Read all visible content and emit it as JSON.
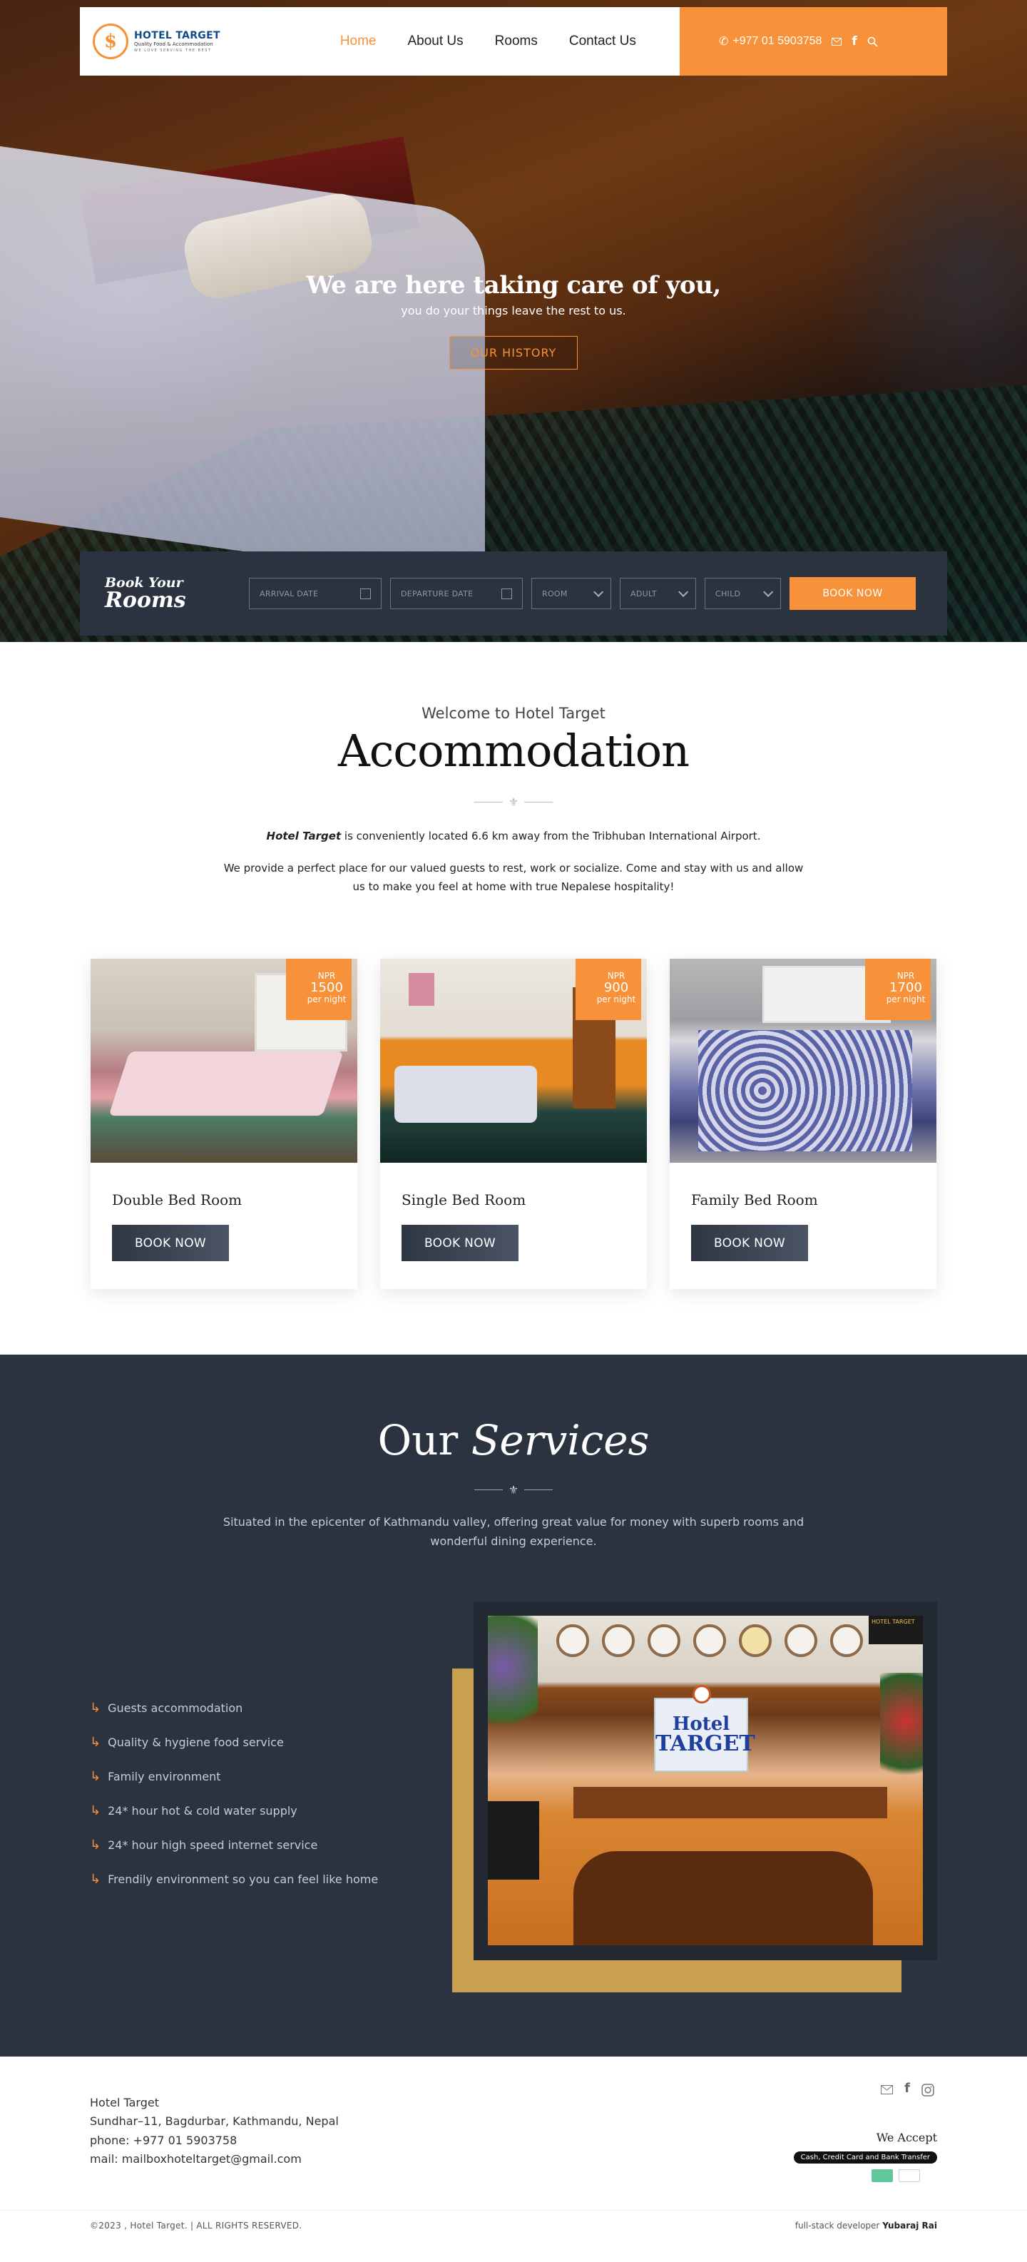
{
  "header": {
    "logo": {
      "name": "HOTEL TARGET",
      "tagline": "Quality Food & Accommodation",
      "motto": "WE LOVE SERVING THE BEST"
    },
    "nav": [
      {
        "label": "Home"
      },
      {
        "label": "About Us"
      },
      {
        "label": "Rooms"
      },
      {
        "label": "Contact Us"
      }
    ],
    "phone": "+977 01 5903758",
    "icons": [
      "mail-icon",
      "facebook-icon",
      "search-icon"
    ]
  },
  "hero": {
    "title": "We are here taking care of you,",
    "subtitle": "you do your things leave the rest to us.",
    "cta": "OUR HISTORY"
  },
  "booking": {
    "title_line1": "Book Your",
    "title_line2": "Rooms",
    "arrival_placeholder": "ARRIVAL DATE",
    "departure_placeholder": "DEPARTURE DATE",
    "room_select": "ROOM",
    "adult_select": "ADULT",
    "child_select": "CHILD",
    "submit": "BOOK NOW"
  },
  "accommodation": {
    "welcome": "Welcome to Hotel Target",
    "title": "Accommodation",
    "desc_brand": "Hotel Target",
    "desc_rest": " is conveniently located 6.6 km away from the Tribhuban International Airport.",
    "desc2": "We provide a perfect place for our valued guests to rest, work or socialize. Come and stay with us and allow us to make you feel at home with true Nepalese hospitality!",
    "rooms": [
      {
        "name": "Double Bed Room",
        "currency": "NPR",
        "price": "1500",
        "unit": "per night",
        "cta": "BOOK NOW"
      },
      {
        "name": "Single Bed Room",
        "currency": "NPR",
        "price": "900",
        "unit": "per night",
        "cta": "BOOK NOW"
      },
      {
        "name": "Family Bed Room",
        "currency": "NPR",
        "price": "1700",
        "unit": "per night",
        "cta": "BOOK NOW"
      }
    ]
  },
  "services": {
    "title_plain": "Our",
    "title_italic": "Services",
    "intro": "Situated in the epicenter of Kathmandu valley, offering great value for money with superb rooms and wonderful dining experience.",
    "items": [
      "Guests accommodation",
      "Quality & hygiene food service",
      "Family environment",
      "24* hour hot & cold water supply",
      "24* hour high speed internet service",
      "Frendily environment so you can feel like home"
    ],
    "photo_sign_line1": "Hotel",
    "photo_sign_line2": "TARGET",
    "photo_board": "HOTEL TARGET"
  },
  "footer": {
    "name": "Hotel Target",
    "address": "Sundhar–11, Bagdurbar, Kathmandu, Nepal",
    "phone": "phone: +977 01 5903758",
    "mail": "mail: mailboxhoteltarget@gmail.com",
    "we_accept": "We Accept",
    "payment": "Cash, Credit Card and Bank Transfer",
    "copyright": "©2023 , Hotel Target. | ALL RIGHTS RESERVED.",
    "dev_prefix": "full-stack developer ",
    "dev_name": "Yubaraj Rai"
  },
  "colors": {
    "accent": "#f7923a",
    "dark": "#2c3340",
    "gold": "#c9a04f"
  }
}
